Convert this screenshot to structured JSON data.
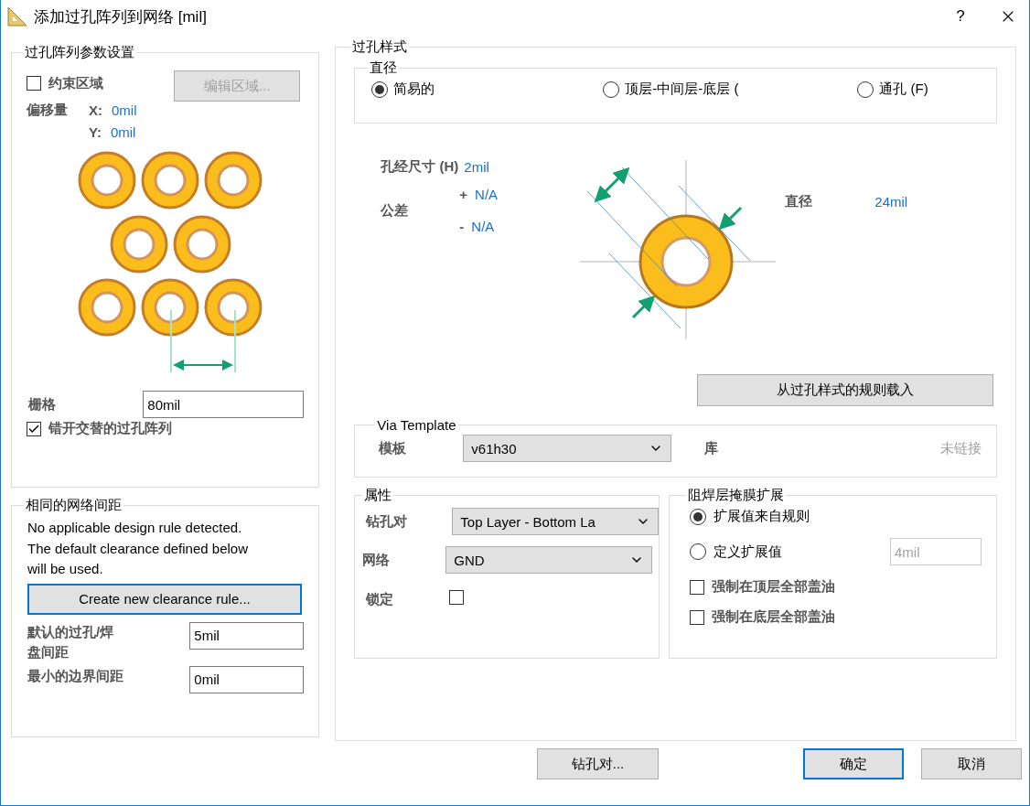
{
  "window": {
    "title": "添加过孔阵列到网络 [mil]",
    "help": "?"
  },
  "array_params": {
    "title": "过孔阵列参数设置",
    "constrain_area": {
      "label": "约束区域",
      "checked": false
    },
    "edit_area_button": {
      "label": "编辑区域...",
      "disabled": true
    },
    "offset": {
      "label": "偏移量",
      "x_label": "X:",
      "x_value": "0mil",
      "y_label": "Y:",
      "y_value": "0mil"
    },
    "grid": {
      "label": "栅格",
      "value": "80mil"
    },
    "stagger": {
      "label": "错开交替的过孔阵列",
      "checked": true
    }
  },
  "clearance": {
    "title": "相同的网络间距",
    "message": "No applicable design rule detected. The default clearance defined below will be used.",
    "create_button": "Create new clearance rule...",
    "fields": [
      {
        "label": "默认的过孔/焊盘间距",
        "value": "5mil"
      },
      {
        "label": "最小的边界间距",
        "value": "0mil"
      }
    ]
  },
  "via_style": {
    "title": "过孔样式",
    "diameter": {
      "title": "直径",
      "options": [
        {
          "label": "简易的",
          "selected": true
        },
        {
          "label": "顶层-中间层-底层 (",
          "selected": false
        },
        {
          "label": "通孔 (F)",
          "selected": false
        }
      ]
    },
    "hole_size": {
      "label": "孔经尺寸 (H)",
      "value": "2mil"
    },
    "tolerance": {
      "label": "公差",
      "plus_sign": "+",
      "plus_value": "N/A",
      "minus_sign": "-",
      "minus_value": "N/A"
    },
    "diameter_value": {
      "label": "直径",
      "value": "24mil"
    },
    "load_button": "从过孔样式的规则载入",
    "via_template": {
      "title": "Via Template",
      "template_label": "模板",
      "template_value": "v61h30",
      "library_label": "库",
      "library_value": "未链接"
    },
    "properties": {
      "title": "属性",
      "drill_pair_label": "钻孔对",
      "drill_pair_value": "Top Layer - Bottom La",
      "net_label": "网络",
      "net_value": "GND",
      "locked_label": "锁定",
      "locked": false
    },
    "solder_mask": {
      "title": "阻焊层掩膜扩展",
      "options": [
        {
          "label": "扩展值来自规则",
          "selected": true
        },
        {
          "label": "定义扩展值",
          "selected": false
        }
      ],
      "custom_value": "4mil",
      "custom_disabled": true,
      "checks": [
        {
          "label": "强制在顶层全部盖油",
          "checked": false
        },
        {
          "label": "强制在底层全部盖油",
          "checked": false
        }
      ]
    }
  },
  "footer": {
    "drill_pairs_button": "钻孔对...",
    "ok_button": "确定",
    "cancel_button": "取消"
  }
}
